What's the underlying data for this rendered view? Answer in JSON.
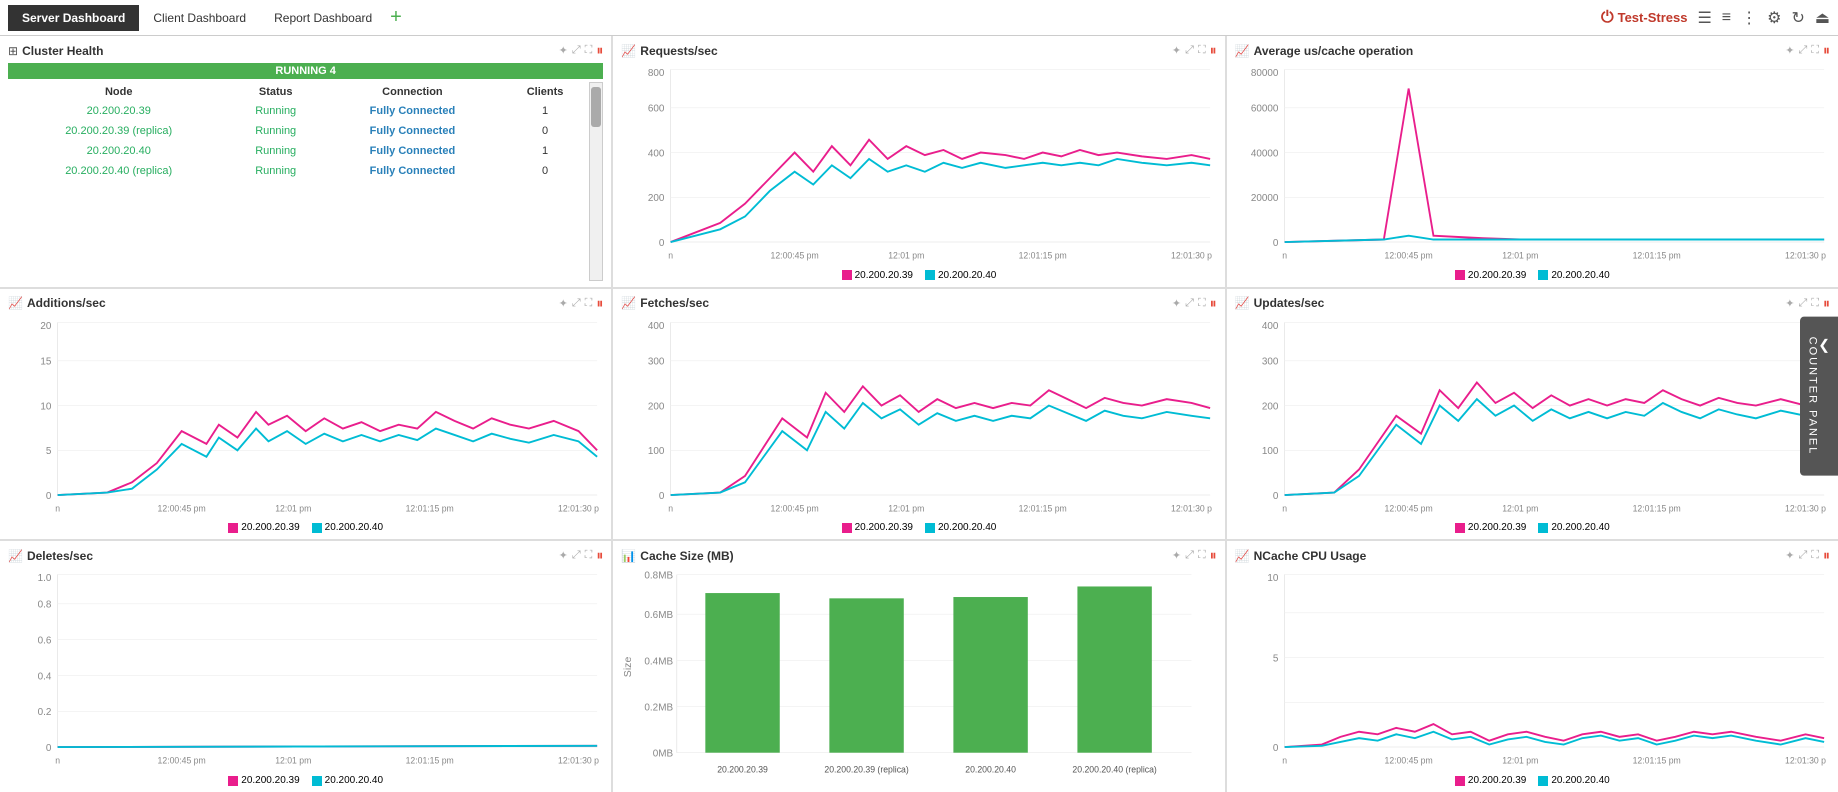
{
  "nav": {
    "tabs": [
      "Server Dashboard",
      "Client Dashboard",
      "Report Dashboard"
    ],
    "active_tab": "Server Dashboard",
    "brand": "Test-Stress",
    "add_label": "+"
  },
  "counter_panel": {
    "label": "COUNTER PANEL"
  },
  "cluster_health": {
    "title": "Cluster Health",
    "running_label": "RUNNING 4",
    "columns": [
      "Node",
      "Status",
      "Connection",
      "Clients"
    ],
    "rows": [
      {
        "node": "20.200.20.39",
        "status": "Running",
        "connection": "Fully Connected",
        "clients": "1"
      },
      {
        "node": "20.200.20.39 (replica)",
        "status": "Running",
        "connection": "Fully Connected",
        "clients": "0"
      },
      {
        "node": "20.200.20.40",
        "status": "Running",
        "connection": "Fully Connected",
        "clients": "1"
      },
      {
        "node": "20.200.20.40 (replica)",
        "status": "Running",
        "connection": "Fully Connected",
        "clients": "0"
      }
    ]
  },
  "requests_sec": {
    "title": "Requests/sec",
    "y_labels": [
      "800",
      "600",
      "400",
      "200",
      "0"
    ],
    "x_labels": [
      "n",
      "12:00:45 pm",
      "12:01 pm",
      "12:01:15 pm",
      "12:01:30 p"
    ],
    "legend": [
      "20.200.20.39",
      "20.200.20.40"
    ],
    "colors": [
      "#e91e8c",
      "#00bcd4"
    ]
  },
  "avg_us_cache": {
    "title": "Average us/cache operation",
    "y_labels": [
      "80000",
      "60000",
      "40000",
      "20000",
      "0"
    ],
    "x_labels": [
      "n",
      "12:00:45 pm",
      "12:01 pm",
      "12:01:15 pm",
      "12:01:30 p"
    ],
    "legend": [
      "20.200.20.39",
      "20.200.20.40"
    ],
    "colors": [
      "#e91e8c",
      "#00bcd4"
    ]
  },
  "additions_sec": {
    "title": "Additions/sec",
    "y_labels": [
      "20",
      "15",
      "10",
      "5",
      "0"
    ],
    "x_labels": [
      "n",
      "12:00:45 pm",
      "12:01 pm",
      "12:01:15 pm",
      "12:01:30 p"
    ],
    "legend": [
      "20.200.20.39",
      "20.200.20.40"
    ],
    "colors": [
      "#e91e8c",
      "#00bcd4"
    ]
  },
  "fetches_sec": {
    "title": "Fetches/sec",
    "y_labels": [
      "400",
      "300",
      "200",
      "100",
      "0"
    ],
    "x_labels": [
      "n",
      "12:00:45 pm",
      "12:01 pm",
      "12:01:15 pm",
      "12:01:30 p"
    ],
    "legend": [
      "20.200.20.39",
      "20.200.20.40"
    ],
    "colors": [
      "#e91e8c",
      "#00bcd4"
    ]
  },
  "updates_sec": {
    "title": "Updates/sec",
    "y_labels": [
      "400",
      "300",
      "200",
      "100",
      "0"
    ],
    "x_labels": [
      "n",
      "12:00:45 pm",
      "12:01 pm",
      "12:01:15 pm",
      "12:01:30 p"
    ],
    "legend": [
      "20.200.20.39",
      "20.200.20.40"
    ],
    "colors": [
      "#e91e8c",
      "#00bcd4"
    ]
  },
  "deletes_sec": {
    "title": "Deletes/sec",
    "y_labels": [
      "1.0",
      "0.8",
      "0.6",
      "0.4",
      "0.2",
      "0"
    ],
    "x_labels": [
      "n",
      "12:00:45 pm",
      "12:01 pm",
      "12:01:15 pm",
      "12:01:30 p"
    ],
    "legend": [
      "20.200.20.39",
      "20.200.20.40"
    ],
    "colors": [
      "#e91e8c",
      "#00bcd4"
    ]
  },
  "cache_size": {
    "title": "Cache Size (MB)",
    "y_labels": [
      "0.8MB",
      "0.6MB",
      "0.4MB",
      "0.2MB",
      "0MB"
    ],
    "y_axis_label": "Size",
    "bars": [
      {
        "label": "20.200.20.39",
        "value": 0.72,
        "color": "#4caf50"
      },
      {
        "label": "20.200.20.39 (replica)",
        "value": 0.69,
        "color": "#4caf50"
      },
      {
        "label": "20.200.20.40",
        "value": 0.7,
        "color": "#4caf50"
      },
      {
        "label": "20.200.20.40 (replica)",
        "value": 0.75,
        "color": "#4caf50"
      }
    ],
    "max": 0.8
  },
  "ncache_cpu": {
    "title": "NCache CPU Usage",
    "y_labels": [
      "10",
      "",
      "5",
      "",
      "0"
    ],
    "x_labels": [
      "n",
      "12:00:45 pm",
      "12:01 pm",
      "12:01:15 pm",
      "12:01:30 p"
    ],
    "legend": [
      "20.200.20.39",
      "20.200.20.40"
    ],
    "colors": [
      "#e91e8c",
      "#00bcd4"
    ]
  }
}
